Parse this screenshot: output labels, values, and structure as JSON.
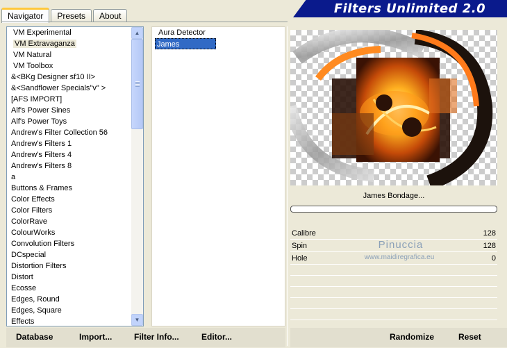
{
  "tabs": [
    {
      "label": "Navigator",
      "active": true
    },
    {
      "label": "Presets",
      "active": false
    },
    {
      "label": "About",
      "active": false
    }
  ],
  "banner": {
    "title": "Filters Unlimited 2.0",
    "color": "#0a1a8c"
  },
  "categories": [
    "VM Experimental",
    "VM Extravaganza",
    "VM Natural",
    "VM Toolbox",
    "&<BKg Designer sf10 II>",
    "&<Sandflower Specials\"v\" >",
    "[AFS IMPORT]",
    "Alf's Power Sines",
    "Alf's Power Toys",
    "Andrew's Filter Collection 56",
    "Andrew's Filters 1",
    "Andrew's Filters 4",
    "Andrew's Filters 8",
    "a",
    "Buttons & Frames",
    "Color Effects",
    "Color Filters",
    "ColorRave",
    "ColourWorks",
    "Convolution Filters",
    "DCspecial",
    "Distortion Filters",
    "Distort",
    "Ecosse",
    "Edges, Round",
    "Edges, Square",
    "Effects"
  ],
  "selected_category": "VM Extravaganza",
  "effects": [
    "Aura Detector",
    "James Bondage..."
  ],
  "selected_effect": "James Bondage...",
  "preview": {
    "filter_name": "James Bondage..."
  },
  "params": [
    {
      "label": "Calibre",
      "value": "128"
    },
    {
      "label": "Spin",
      "value": "128"
    },
    {
      "label": "Hole",
      "value": "0"
    }
  ],
  "watermark": {
    "name": "Pinuccia",
    "url": "www.maidiregrafica.eu"
  },
  "buttons": {
    "database": "Database",
    "import": "Import...",
    "filter_info": "Filter Info...",
    "editor": "Editor...",
    "randomize": "Randomize",
    "reset": "Reset"
  },
  "icons": {
    "scroll_up": "chevron-up-icon",
    "scroll_down": "chevron-down-icon"
  }
}
